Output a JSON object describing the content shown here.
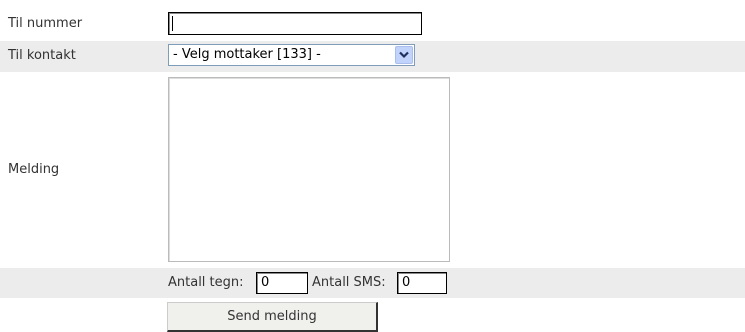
{
  "form": {
    "number": {
      "label": "Til nummer",
      "value": ""
    },
    "contact": {
      "label": "Til kontakt",
      "selected": "- Velg mottaker [133] -"
    },
    "message": {
      "label": "Melding",
      "value": ""
    },
    "counts": {
      "chars_label": "Antall tegn:",
      "chars_value": "0",
      "sms_label": "Antall SMS:",
      "sms_value": "0"
    },
    "send_label": "Send melding"
  },
  "icons": {
    "select_arrow": "chevron-down-icon"
  },
  "colors": {
    "row_shade": "#ececec",
    "select_button": "#c1d3fb",
    "select_border": "#7f9db9"
  }
}
